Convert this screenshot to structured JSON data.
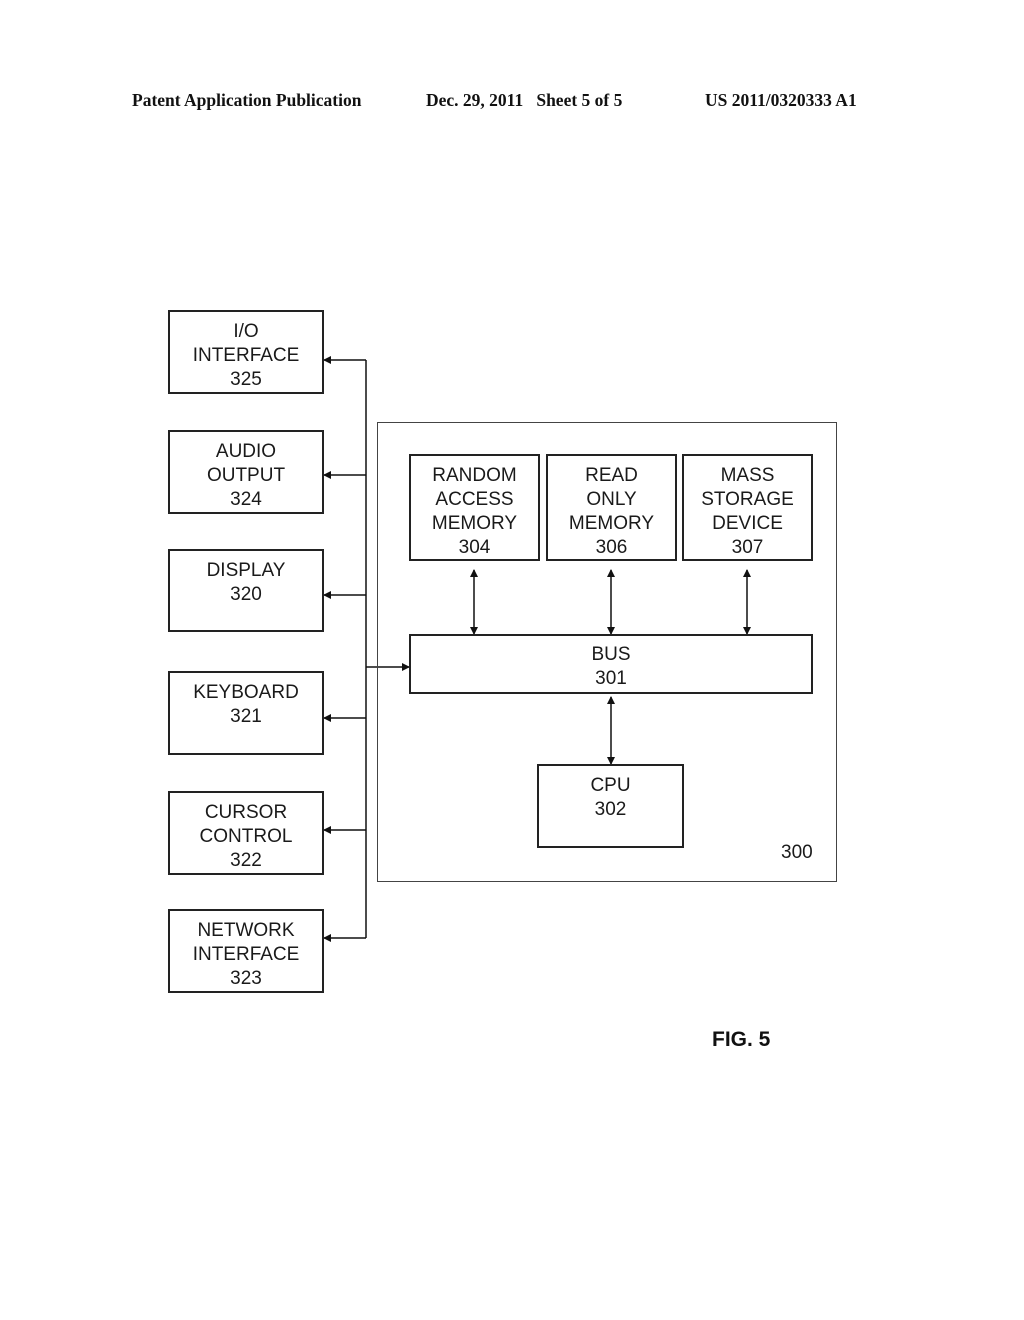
{
  "header": {
    "publication": "Patent Application Publication",
    "date_sheet": "Dec. 29, 2011   Sheet 5 of 5",
    "patent_number": "US 2011/0320333 A1"
  },
  "diagram": {
    "system_label": "300",
    "peripherals": [
      {
        "lines": [
          "I/O",
          "INTERFACE",
          "325"
        ]
      },
      {
        "lines": [
          "AUDIO",
          "OUTPUT",
          "324"
        ]
      },
      {
        "lines": [
          "DISPLAY",
          "320"
        ]
      },
      {
        "lines": [
          "KEYBOARD",
          "321"
        ]
      },
      {
        "lines": [
          "CURSOR",
          "CONTROL",
          "322"
        ]
      },
      {
        "lines": [
          "NETWORK",
          "INTERFACE",
          "323"
        ]
      }
    ],
    "memory": [
      {
        "lines": [
          "RANDOM",
          "ACCESS",
          "MEMORY",
          "304"
        ]
      },
      {
        "lines": [
          "READ",
          "ONLY",
          "MEMORY",
          "306"
        ]
      },
      {
        "lines": [
          "MASS",
          "STORAGE",
          "DEVICE",
          "307"
        ]
      }
    ],
    "bus": {
      "lines": [
        "BUS",
        "301"
      ]
    },
    "cpu": {
      "lines": [
        "CPU",
        "302"
      ]
    },
    "edges": [
      {
        "from": "bus-301",
        "to": "io-interface-325",
        "type": "arrow"
      },
      {
        "from": "bus-301",
        "to": "audio-output-324",
        "type": "arrow"
      },
      {
        "from": "bus-301",
        "to": "display-320",
        "type": "arrow"
      },
      {
        "from": "bus-301",
        "to": "keyboard-321",
        "type": "arrow"
      },
      {
        "from": "bus-301",
        "to": "cursor-control-322",
        "type": "arrow"
      },
      {
        "from": "bus-301",
        "to": "network-interface-323",
        "type": "arrow"
      },
      {
        "from": "random-access-memory-304",
        "to": "bus-301",
        "type": "bidirectional"
      },
      {
        "from": "read-only-memory-306",
        "to": "bus-301",
        "type": "bidirectional"
      },
      {
        "from": "mass-storage-device-307",
        "to": "bus-301",
        "type": "bidirectional"
      },
      {
        "from": "bus-301",
        "to": "cpu-302",
        "type": "bidirectional"
      }
    ]
  },
  "figure_label": "FIG. 5"
}
